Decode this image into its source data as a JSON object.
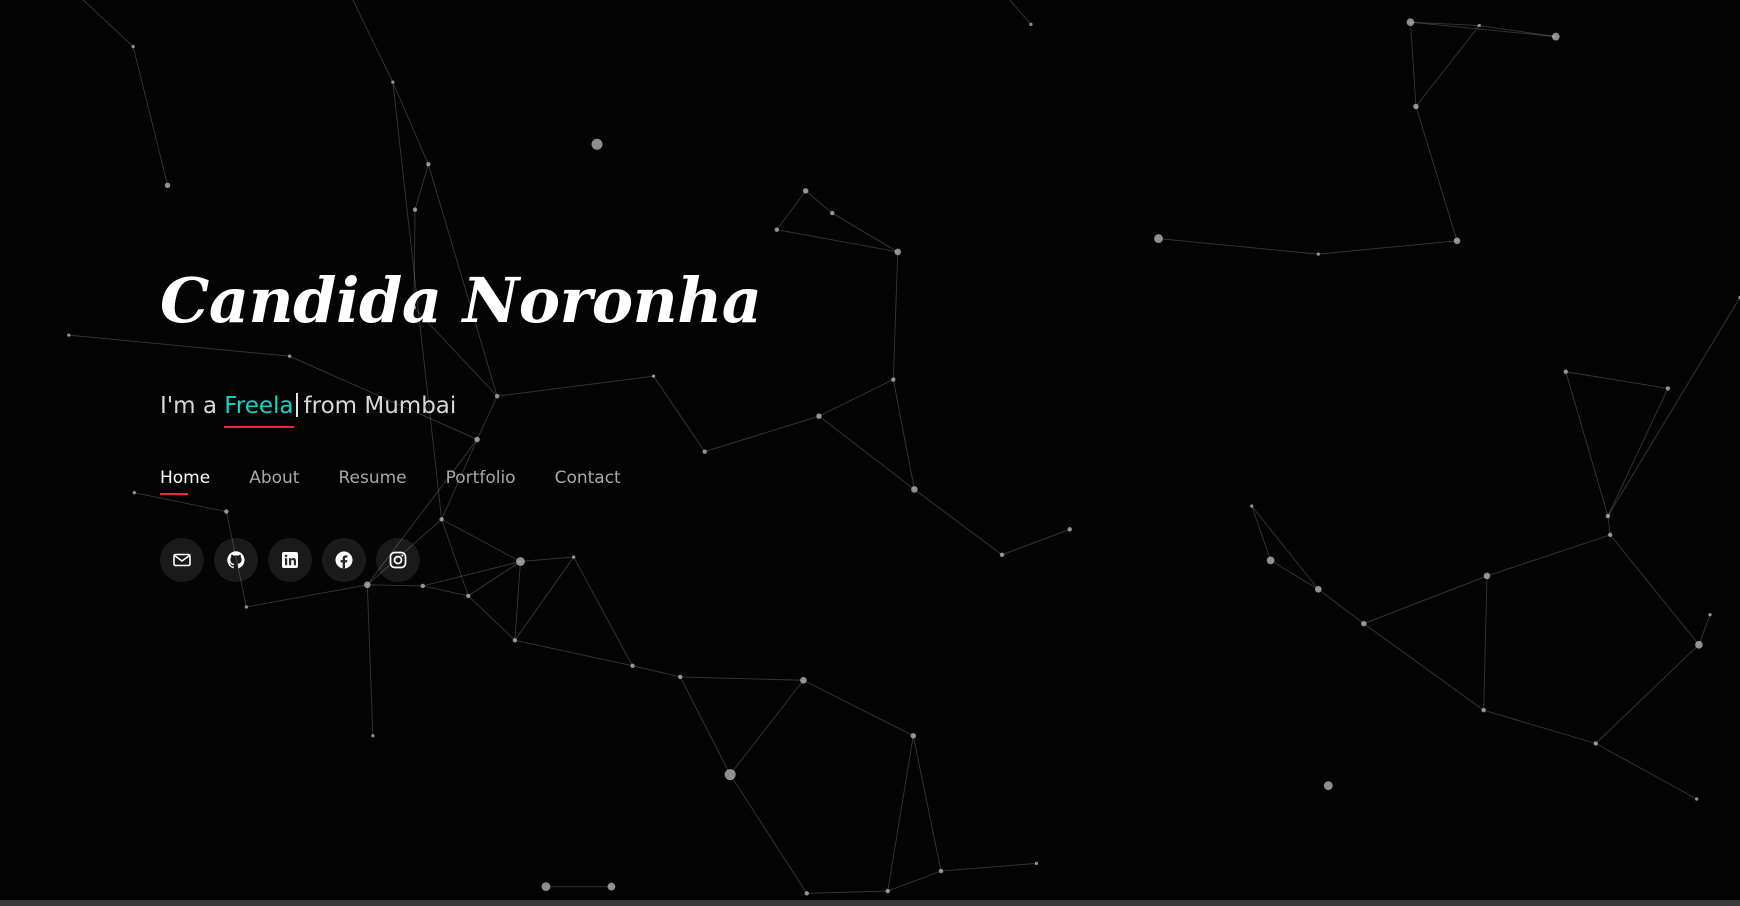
{
  "hero": {
    "name": "Candida Noronha",
    "tagline_prefix": "I'm a",
    "tagline_typed": "Freela",
    "tagline_suffix": "from Mumbai"
  },
  "nav": {
    "items": [
      {
        "label": "Home",
        "active": true
      },
      {
        "label": "About",
        "active": false
      },
      {
        "label": "Resume",
        "active": false
      },
      {
        "label": "Portfolio",
        "active": false
      },
      {
        "label": "Contact",
        "active": false
      }
    ]
  },
  "socials": [
    {
      "icon": "envelope-icon"
    },
    {
      "icon": "github-icon"
    },
    {
      "icon": "linkedin-icon"
    },
    {
      "icon": "facebook-icon"
    },
    {
      "icon": "instagram-icon"
    }
  ],
  "colors": {
    "background": "#040404",
    "accent": "#18d2c6",
    "underline": "#e9283e",
    "text": "#ffffff"
  }
}
